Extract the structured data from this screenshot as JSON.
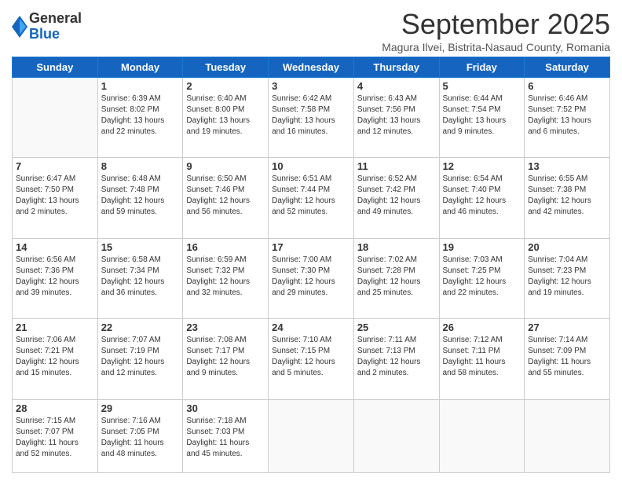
{
  "logo": {
    "general": "General",
    "blue": "Blue"
  },
  "title": "September 2025",
  "subtitle": "Magura Ilvei, Bistrita-Nasaud County, Romania",
  "days": [
    "Sunday",
    "Monday",
    "Tuesday",
    "Wednesday",
    "Thursday",
    "Friday",
    "Saturday"
  ],
  "weeks": [
    [
      {
        "day": "",
        "info": ""
      },
      {
        "day": "1",
        "info": "Sunrise: 6:39 AM\nSunset: 8:02 PM\nDaylight: 13 hours\nand 22 minutes."
      },
      {
        "day": "2",
        "info": "Sunrise: 6:40 AM\nSunset: 8:00 PM\nDaylight: 13 hours\nand 19 minutes."
      },
      {
        "day": "3",
        "info": "Sunrise: 6:42 AM\nSunset: 7:58 PM\nDaylight: 13 hours\nand 16 minutes."
      },
      {
        "day": "4",
        "info": "Sunrise: 6:43 AM\nSunset: 7:56 PM\nDaylight: 13 hours\nand 12 minutes."
      },
      {
        "day": "5",
        "info": "Sunrise: 6:44 AM\nSunset: 7:54 PM\nDaylight: 13 hours\nand 9 minutes."
      },
      {
        "day": "6",
        "info": "Sunrise: 6:46 AM\nSunset: 7:52 PM\nDaylight: 13 hours\nand 6 minutes."
      }
    ],
    [
      {
        "day": "7",
        "info": "Sunrise: 6:47 AM\nSunset: 7:50 PM\nDaylight: 13 hours\nand 2 minutes."
      },
      {
        "day": "8",
        "info": "Sunrise: 6:48 AM\nSunset: 7:48 PM\nDaylight: 12 hours\nand 59 minutes."
      },
      {
        "day": "9",
        "info": "Sunrise: 6:50 AM\nSunset: 7:46 PM\nDaylight: 12 hours\nand 56 minutes."
      },
      {
        "day": "10",
        "info": "Sunrise: 6:51 AM\nSunset: 7:44 PM\nDaylight: 12 hours\nand 52 minutes."
      },
      {
        "day": "11",
        "info": "Sunrise: 6:52 AM\nSunset: 7:42 PM\nDaylight: 12 hours\nand 49 minutes."
      },
      {
        "day": "12",
        "info": "Sunrise: 6:54 AM\nSunset: 7:40 PM\nDaylight: 12 hours\nand 46 minutes."
      },
      {
        "day": "13",
        "info": "Sunrise: 6:55 AM\nSunset: 7:38 PM\nDaylight: 12 hours\nand 42 minutes."
      }
    ],
    [
      {
        "day": "14",
        "info": "Sunrise: 6:56 AM\nSunset: 7:36 PM\nDaylight: 12 hours\nand 39 minutes."
      },
      {
        "day": "15",
        "info": "Sunrise: 6:58 AM\nSunset: 7:34 PM\nDaylight: 12 hours\nand 36 minutes."
      },
      {
        "day": "16",
        "info": "Sunrise: 6:59 AM\nSunset: 7:32 PM\nDaylight: 12 hours\nand 32 minutes."
      },
      {
        "day": "17",
        "info": "Sunrise: 7:00 AM\nSunset: 7:30 PM\nDaylight: 12 hours\nand 29 minutes."
      },
      {
        "day": "18",
        "info": "Sunrise: 7:02 AM\nSunset: 7:28 PM\nDaylight: 12 hours\nand 25 minutes."
      },
      {
        "day": "19",
        "info": "Sunrise: 7:03 AM\nSunset: 7:25 PM\nDaylight: 12 hours\nand 22 minutes."
      },
      {
        "day": "20",
        "info": "Sunrise: 7:04 AM\nSunset: 7:23 PM\nDaylight: 12 hours\nand 19 minutes."
      }
    ],
    [
      {
        "day": "21",
        "info": "Sunrise: 7:06 AM\nSunset: 7:21 PM\nDaylight: 12 hours\nand 15 minutes."
      },
      {
        "day": "22",
        "info": "Sunrise: 7:07 AM\nSunset: 7:19 PM\nDaylight: 12 hours\nand 12 minutes."
      },
      {
        "day": "23",
        "info": "Sunrise: 7:08 AM\nSunset: 7:17 PM\nDaylight: 12 hours\nand 9 minutes."
      },
      {
        "day": "24",
        "info": "Sunrise: 7:10 AM\nSunset: 7:15 PM\nDaylight: 12 hours\nand 5 minutes."
      },
      {
        "day": "25",
        "info": "Sunrise: 7:11 AM\nSunset: 7:13 PM\nDaylight: 12 hours\nand 2 minutes."
      },
      {
        "day": "26",
        "info": "Sunrise: 7:12 AM\nSunset: 7:11 PM\nDaylight: 11 hours\nand 58 minutes."
      },
      {
        "day": "27",
        "info": "Sunrise: 7:14 AM\nSunset: 7:09 PM\nDaylight: 11 hours\nand 55 minutes."
      }
    ],
    [
      {
        "day": "28",
        "info": "Sunrise: 7:15 AM\nSunset: 7:07 PM\nDaylight: 11 hours\nand 52 minutes."
      },
      {
        "day": "29",
        "info": "Sunrise: 7:16 AM\nSunset: 7:05 PM\nDaylight: 11 hours\nand 48 minutes."
      },
      {
        "day": "30",
        "info": "Sunrise: 7:18 AM\nSunset: 7:03 PM\nDaylight: 11 hours\nand 45 minutes."
      },
      {
        "day": "",
        "info": ""
      },
      {
        "day": "",
        "info": ""
      },
      {
        "day": "",
        "info": ""
      },
      {
        "day": "",
        "info": ""
      }
    ]
  ]
}
